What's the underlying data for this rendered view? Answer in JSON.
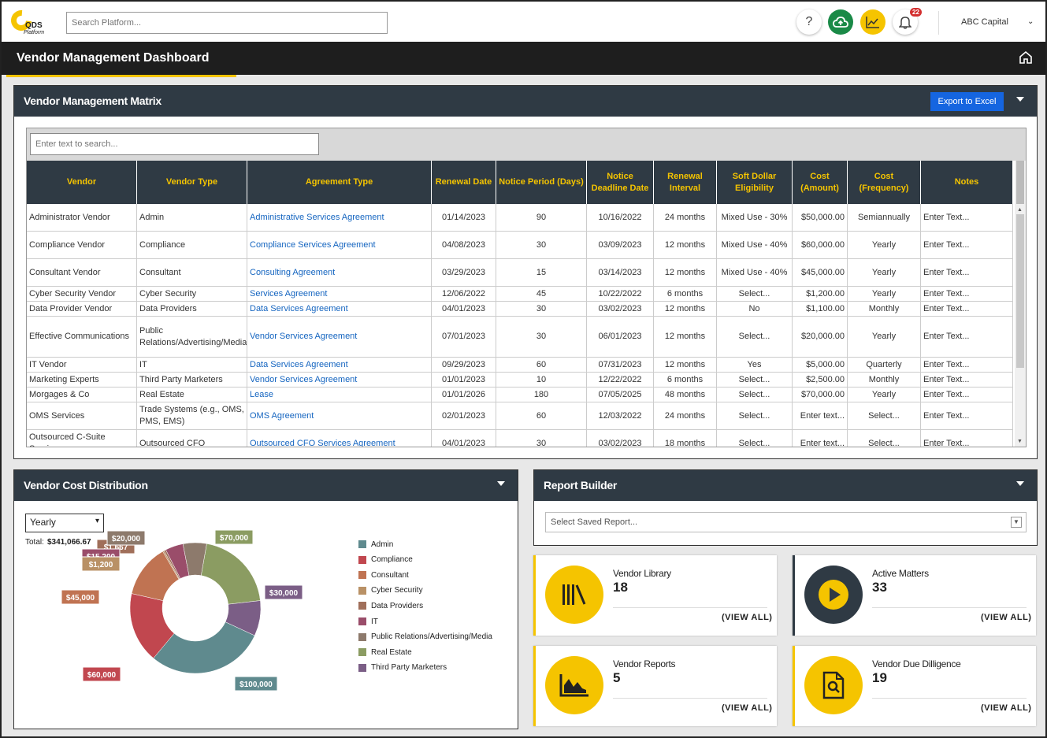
{
  "header": {
    "logo_text": "QDS",
    "logo_sub": "Platform",
    "search_placeholder": "Search Platform...",
    "help_label": "?",
    "notif_count": "22",
    "company": "ABC Capital",
    "company_caret": "⌄"
  },
  "page": {
    "title": "Vendor Management Dashboard"
  },
  "matrix": {
    "title": "Vendor Management Matrix",
    "export_label": "Export to Excel",
    "search_placeholder": "Enter text to search...",
    "columns": [
      "Vendor",
      "Vendor Type",
      "Agreement Type",
      "Renewal Date",
      "Notice Period (Days)",
      "Notice Deadline Date",
      "Renewal Interval",
      "Soft Dollar Eligibility",
      "Cost (Amount)",
      "Cost (Frequency)",
      "Notes"
    ],
    "rows": [
      [
        "Administrator Vendor",
        "Admin",
        "Administrative Services Agreement",
        "01/14/2023",
        "90",
        "10/16/2022",
        "24 months",
        "Mixed Use - 30%",
        "$50,000.00",
        "Semiannually",
        "Enter Text..."
      ],
      [
        "Compliance Vendor",
        "Compliance",
        "Compliance Services Agreement",
        "04/08/2023",
        "30",
        "03/09/2023",
        "12 months",
        "Mixed Use - 40%",
        "$60,000.00",
        "Yearly",
        "Enter Text..."
      ],
      [
        "Consultant Vendor",
        "Consultant",
        "Consulting Agreement",
        "03/29/2023",
        "15",
        "03/14/2023",
        "12 months",
        "Mixed Use - 40%",
        "$45,000.00",
        "Yearly",
        "Enter Text..."
      ],
      [
        "Cyber Security Vendor",
        "Cyber Security",
        "Services Agreement",
        "12/06/2022",
        "45",
        "10/22/2022",
        "6 months",
        "Select...",
        "$1,200.00",
        "Yearly",
        "Enter Text..."
      ],
      [
        "Data Provider Vendor",
        "Data Providers",
        "Data Services Agreement",
        "04/01/2023",
        "30",
        "03/02/2023",
        "12 months",
        "No",
        "$1,100.00",
        "Monthly",
        "Enter Text..."
      ],
      [
        "Effective Communications",
        "Public Relations/Advertising/Media",
        "Vendor Services Agreement",
        "07/01/2023",
        "30",
        "06/01/2023",
        "12 months",
        "Select...",
        "$20,000.00",
        "Yearly",
        "Enter Text..."
      ],
      [
        "IT Vendor",
        "IT",
        "Data Services Agreement",
        "09/29/2023",
        "60",
        "07/31/2023",
        "12 months",
        "Yes",
        "$5,000.00",
        "Quarterly",
        "Enter Text..."
      ],
      [
        "Marketing Experts",
        "Third Party Marketers",
        "Vendor Services Agreement",
        "01/01/2023",
        "10",
        "12/22/2022",
        "6 months",
        "Select...",
        "$2,500.00",
        "Monthly",
        "Enter Text..."
      ],
      [
        "Morgages & Co",
        "Real Estate",
        "Lease",
        "01/01/2026",
        "180",
        "07/05/2025",
        "48 months",
        "Select...",
        "$70,000.00",
        "Yearly",
        "Enter Text..."
      ],
      [
        "OMS Services",
        "Trade Systems (e.g., OMS, PMS, EMS)",
        "OMS Agreement",
        "02/01/2023",
        "60",
        "12/03/2022",
        "24 months",
        "Select...",
        "Enter text...",
        "Select...",
        "Enter Text..."
      ],
      [
        "Outsourced C-Suite Services",
        "Outsourced CFO",
        "Outsourced CFO Services Agreement",
        "04/01/2023",
        "30",
        "03/02/2023",
        "18 months",
        "Select...",
        "Enter text...",
        "Select...",
        "Enter Text..."
      ]
    ]
  },
  "cost": {
    "title": "Vendor Cost Distribution",
    "period": "Yearly",
    "total_label": "Total:",
    "total_value": "$341,066.67",
    "legend": [
      "Admin",
      "Compliance",
      "Consultant",
      "Cyber Security",
      "Data Providers",
      "IT",
      "Public Relations/Advertising/Media",
      "Real Estate",
      "Third Party Marketers"
    ],
    "colors": {
      "Admin": "#5f8a8e",
      "Compliance": "#c1474f",
      "Consultant": "#c07352",
      "Cyber Security": "#b99166",
      "Data Providers": "#a06f5a",
      "IT": "#9a4d6a",
      "Public Relations/Advertising/Media": "#8d7a6c",
      "Real Estate": "#8b9c62",
      "Third Party Marketers": "#7b5e86"
    },
    "labels": {
      "re": "$70,000",
      "tpm": "$30,000",
      "admin": "$100,000",
      "comp": "$60,000",
      "cons": "$45,000",
      "pr": "$20,000",
      "dp": "$1,667",
      "it": "$15,200",
      "cyber": "$1,200"
    }
  },
  "chart_data": {
    "type": "pie",
    "title": "Vendor Cost Distribution",
    "categories": [
      "Admin",
      "Compliance",
      "Consultant",
      "Cyber Security",
      "Data Providers",
      "IT",
      "Public Relations/Advertising/Media",
      "Real Estate",
      "Third Party Marketers"
    ],
    "values": [
      100000,
      60000,
      45000,
      1200,
      1667,
      15200,
      20000,
      70000,
      30000
    ],
    "total": 341066.67,
    "legend": "right",
    "donut": true
  },
  "report": {
    "title": "Report Builder",
    "saved_placeholder": "Select Saved Report..."
  },
  "cards": [
    {
      "title": "Vendor Library",
      "count": "18",
      "link": "(VIEW ALL)",
      "icon": "library-icon"
    },
    {
      "title": "Active Matters",
      "count": "33",
      "link": "(VIEW ALL)",
      "icon": "play-icon"
    },
    {
      "title": "Vendor Reports",
      "count": "5",
      "link": "(VIEW ALL)",
      "icon": "area-chart-icon"
    },
    {
      "title": "Vendor Due Dilligence",
      "count": "19",
      "link": "(VIEW ALL)",
      "icon": "document-search-icon"
    }
  ]
}
